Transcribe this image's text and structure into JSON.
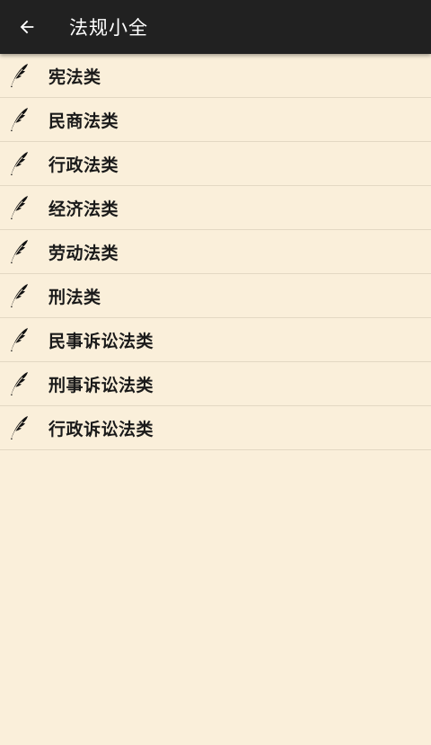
{
  "app": {
    "title": "法规小全",
    "back_icon": "arrow-left-icon"
  },
  "list": {
    "item_icon": "quill-feather-icon",
    "items": [
      {
        "label": "宪法类"
      },
      {
        "label": "民商法类"
      },
      {
        "label": "行政法类"
      },
      {
        "label": "经济法类"
      },
      {
        "label": "劳动法类"
      },
      {
        "label": "刑法类"
      },
      {
        "label": "民事诉讼法类"
      },
      {
        "label": "刑事诉讼法类"
      },
      {
        "label": "行政诉讼法类"
      }
    ]
  },
  "colors": {
    "appbar_bg": "#212121",
    "page_bg": "#FAEFDA",
    "divider": "#E3D8C3",
    "text": "#1A1A1A"
  }
}
